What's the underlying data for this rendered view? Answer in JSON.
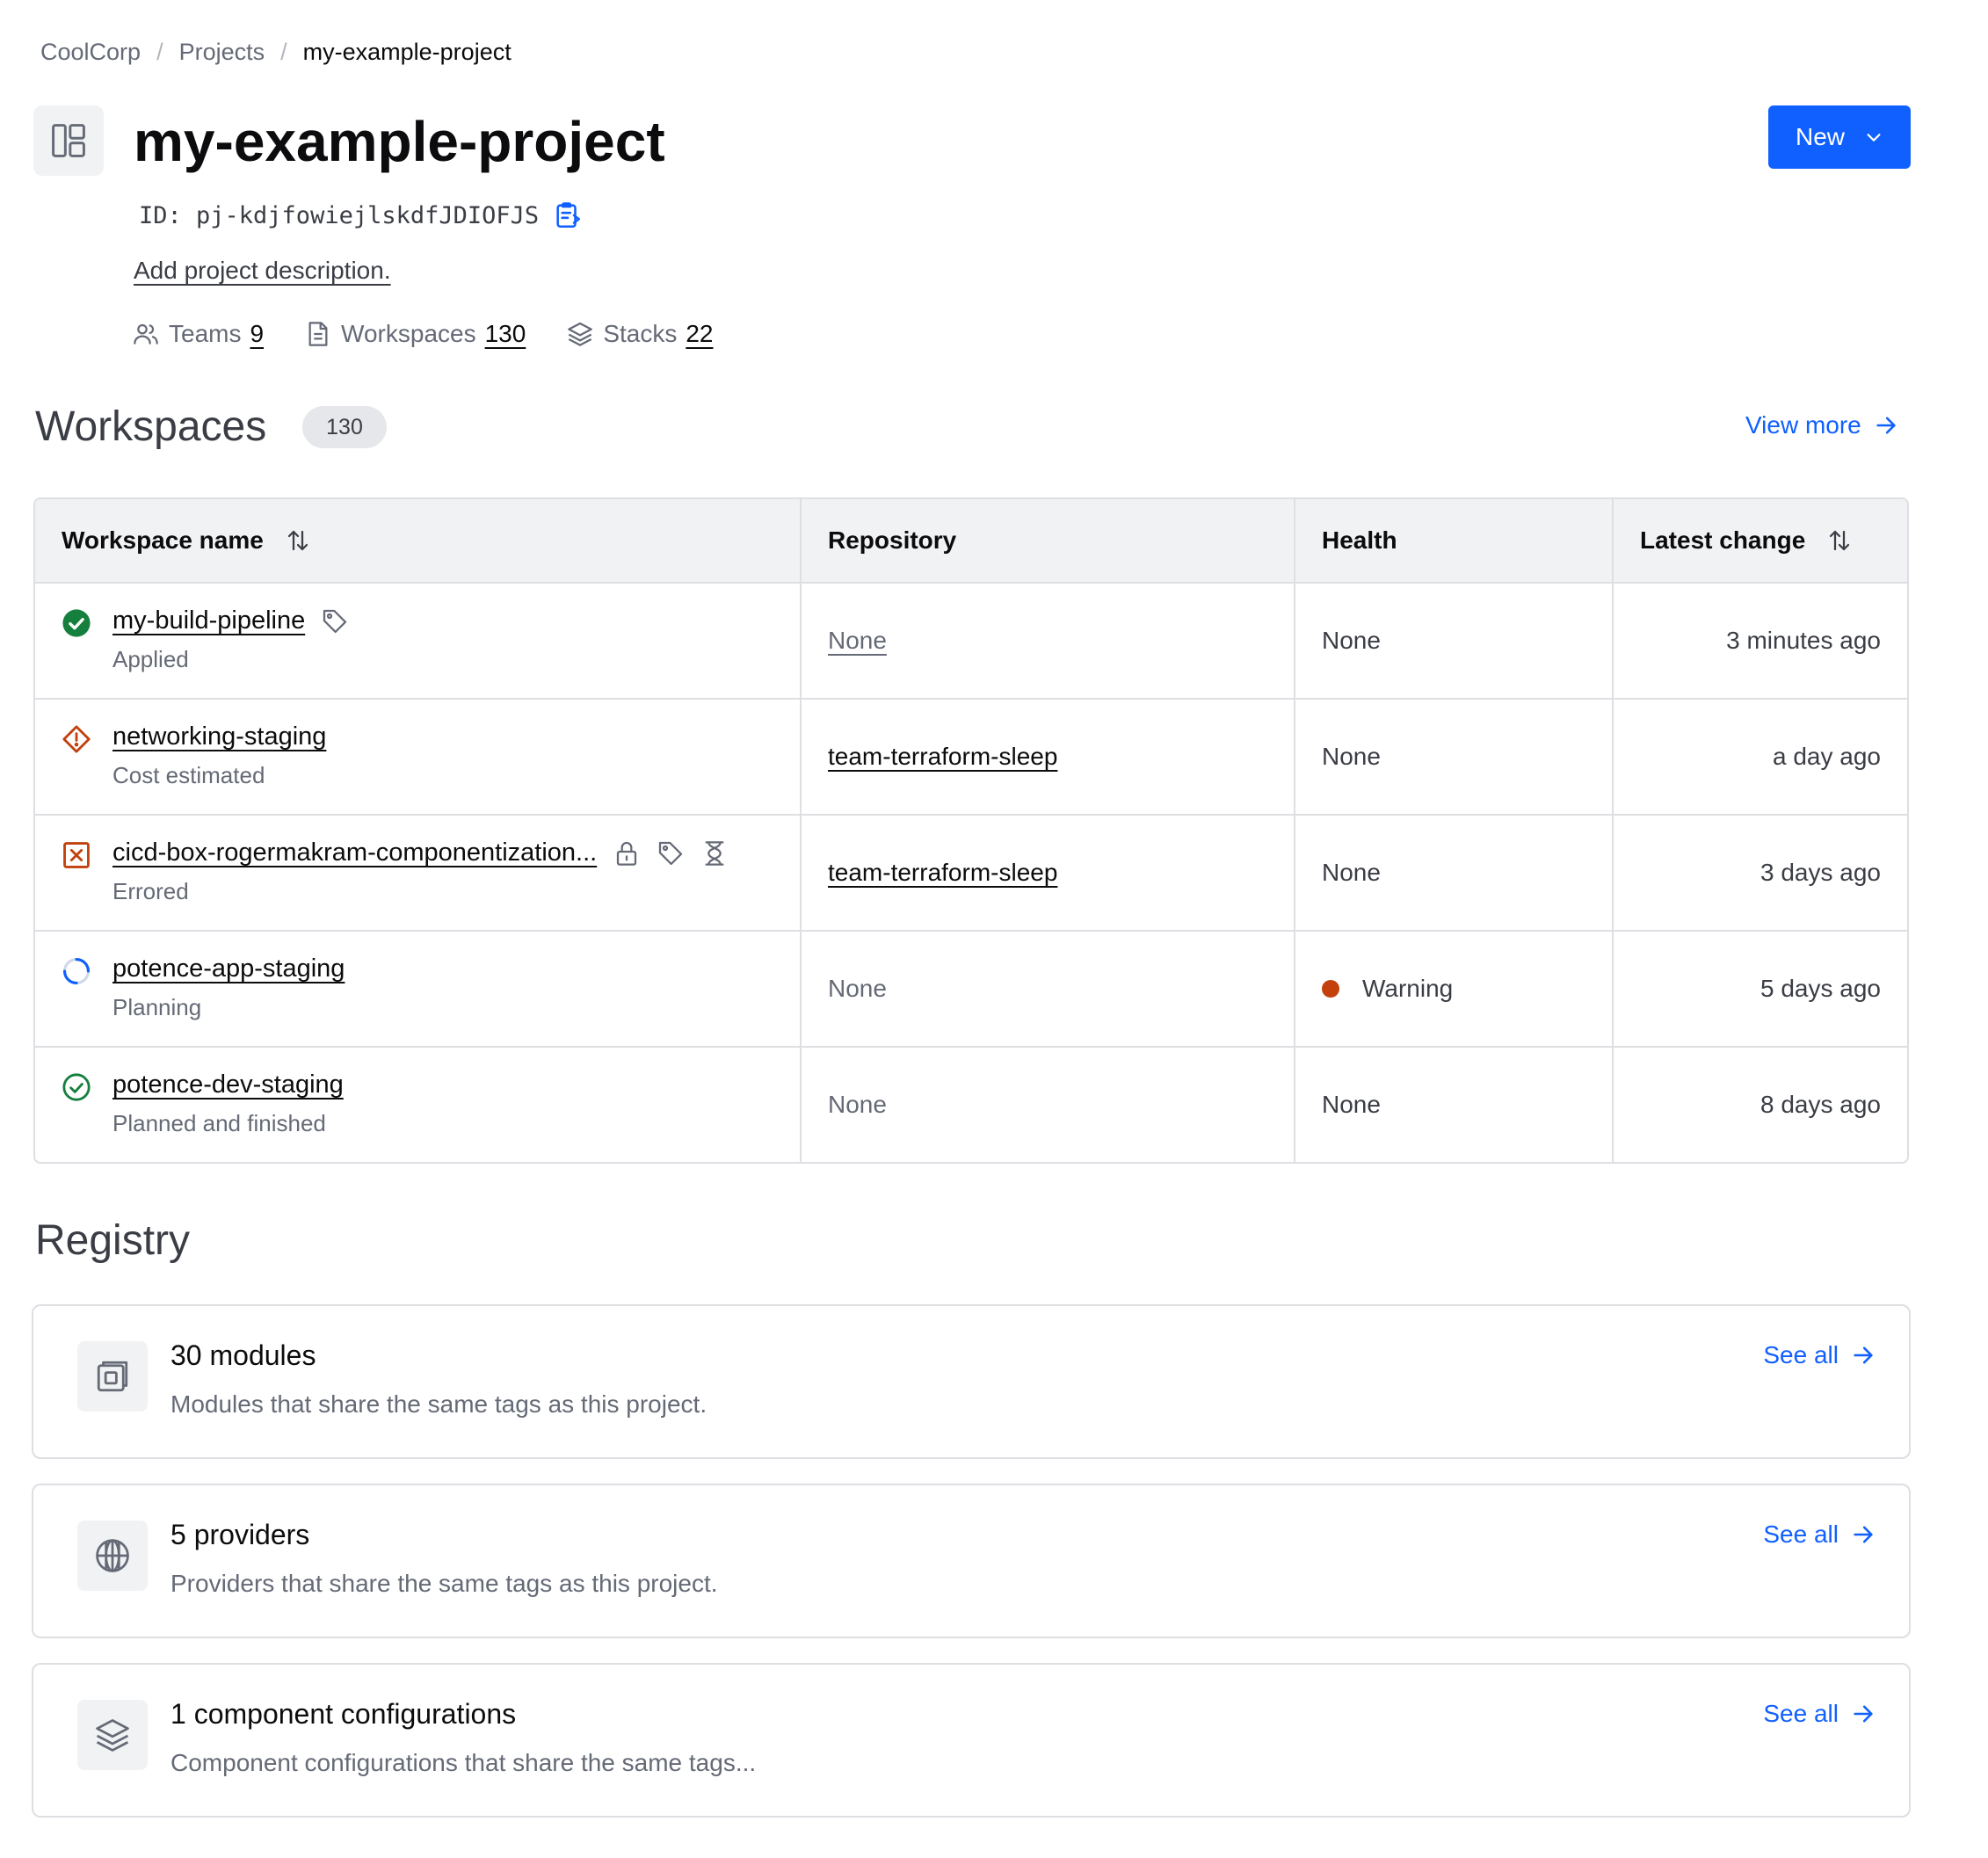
{
  "breadcrumb": {
    "org": "CoolCorp",
    "section": "Projects",
    "current": "my-example-project",
    "separator": "/"
  },
  "project": {
    "title": "my-example-project",
    "id_label": "ID: pj-kdjfowiejlskdfJDIOFJS",
    "add_description": "Add project description."
  },
  "new_button": {
    "label": "New"
  },
  "stats": [
    {
      "label": "Teams",
      "value": "9",
      "icon": "users-icon"
    },
    {
      "label": "Workspaces",
      "value": "130",
      "icon": "file-icon"
    },
    {
      "label": "Stacks",
      "value": "22",
      "icon": "layers-icon"
    }
  ],
  "workspaces_section": {
    "title": "Workspaces",
    "count": "130",
    "view_more": "View more"
  },
  "table": {
    "headers": [
      "Workspace name",
      "Repository",
      "Health",
      "Latest change"
    ],
    "rows": [
      {
        "name": "my-build-pipeline",
        "status": "Applied",
        "status_icon": "check-circle-fill-icon",
        "repository": "None",
        "health": "None",
        "latest_change": "3 minutes ago"
      },
      {
        "name": "networking-staging",
        "status": "Cost estimated",
        "status_icon": "alert-diamond-icon",
        "repository": "team-terraform-sleep",
        "health": "None",
        "latest_change": "a day ago"
      },
      {
        "name": "cicd-box-rogermakram-componentization...",
        "status": "Errored",
        "status_icon": "x-square-icon",
        "repository": "team-terraform-sleep",
        "health": "None",
        "latest_change": "3 days ago"
      },
      {
        "name": "potence-app-staging",
        "status": "Planning",
        "status_icon": "loading-icon",
        "repository": "None",
        "health": "Warning",
        "latest_change": "5 days ago"
      },
      {
        "name": "potence-dev-staging",
        "status": "Planned and finished",
        "status_icon": "check-circle-icon",
        "repository": "None",
        "health": "None",
        "latest_change": "8 days ago"
      }
    ]
  },
  "registry": {
    "title": "Registry",
    "cards": [
      {
        "title": "30 modules",
        "description": "Modules that share the same tags as this project.",
        "link": "See all",
        "icon": "module-icon"
      },
      {
        "title": "5 providers",
        "description": "Providers that share the same tags as this project.",
        "link": "See all",
        "icon": "globe-icon"
      },
      {
        "title": "1 component configurations",
        "description": "Component configurations that share the same tags...",
        "link": "See all",
        "icon": "layers-icon"
      }
    ]
  },
  "colors": {
    "accent": "#1060ff",
    "success": "#15803d",
    "warning": "#c2410c",
    "error": "#c2410c",
    "planning": "#1060ff"
  }
}
